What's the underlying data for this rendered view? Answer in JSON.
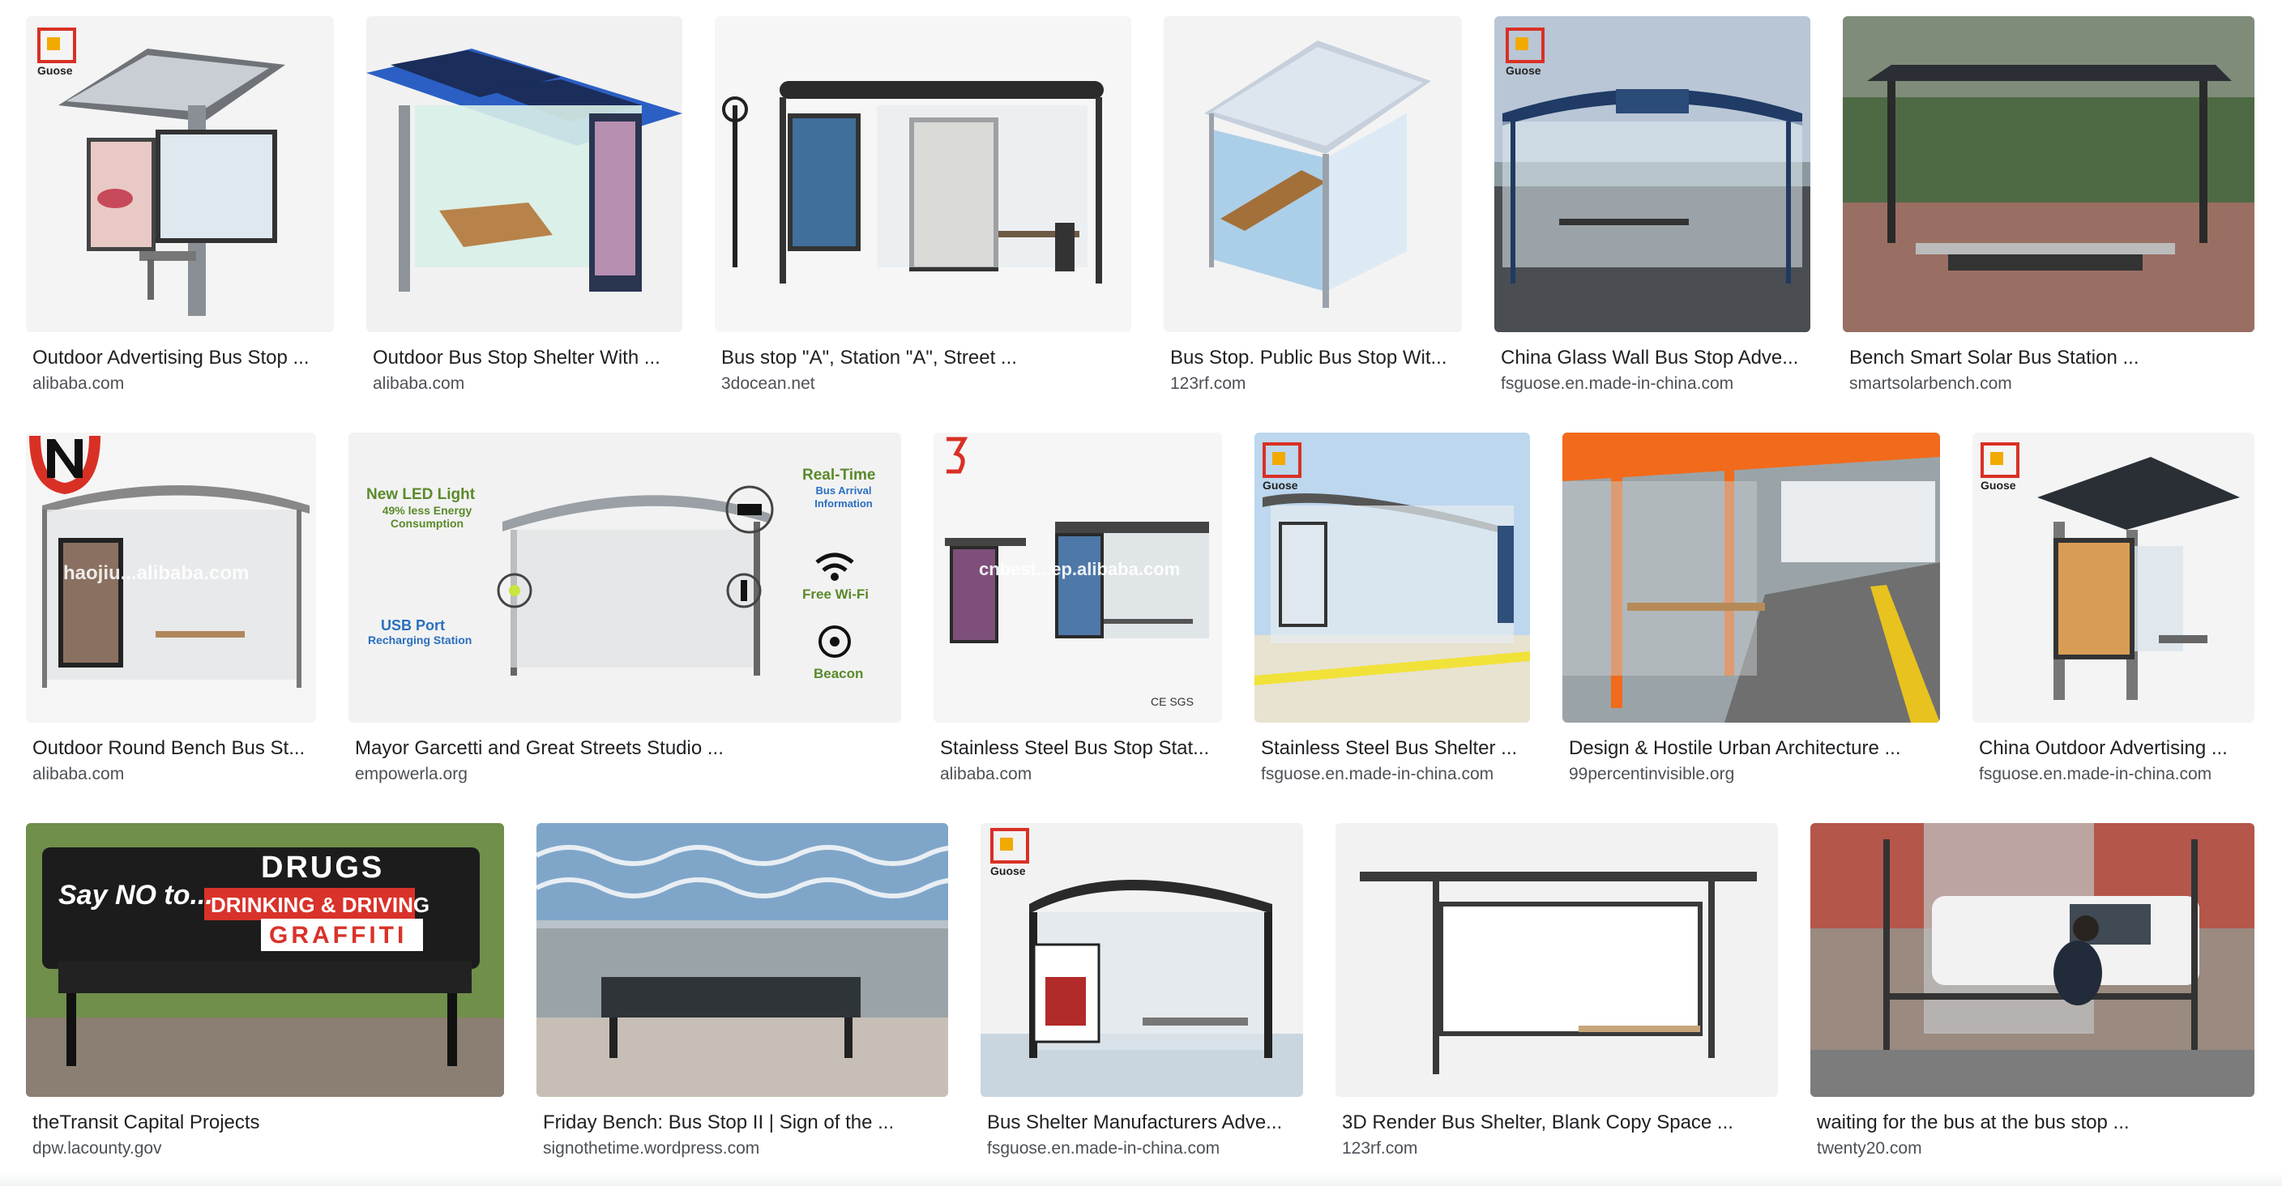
{
  "results": [
    {
      "title": "Outdoor Advertising Bus Stop ...",
      "source": "alibaba.com",
      "logo": "guose"
    },
    {
      "title": "Outdoor Bus Stop Shelter With ...",
      "source": "alibaba.com",
      "logo": ""
    },
    {
      "title": "Bus stop \"A\", Station \"A\", Street ...",
      "source": "3docean.net",
      "logo": ""
    },
    {
      "title": "Bus Stop. Public Bus Stop Wit...",
      "source": "123rf.com",
      "logo": ""
    },
    {
      "title": "China Glass Wall Bus Stop Adve...",
      "source": "fsguose.en.made-in-china.com",
      "logo": "guose"
    },
    {
      "title": "Bench Smart Solar Bus Station ...",
      "source": "smartsolarbench.com",
      "logo": ""
    },
    {
      "title": "Outdoor Round Bench Bus St...",
      "source": "alibaba.com",
      "logo": "",
      "watermark": "haojiu...alibaba.com"
    },
    {
      "title": "Mayor Garcetti and Great Streets Studio ...",
      "source": "empowerla.org",
      "logo": "",
      "infographic": {
        "led": "New LED Light",
        "led_sub": "49% less Energy Consumption",
        "realtime": "Real-Time",
        "realtime_sub": "Bus Arrival Information",
        "wifi": "Free Wi-Fi",
        "usb": "USB Port",
        "usb_sub": "Recharging Station",
        "beacon": "Beacon"
      }
    },
    {
      "title": "Stainless Steel Bus Stop Stat...",
      "source": "alibaba.com",
      "logo": "",
      "watermark": "cnbest...ep.alibaba.com",
      "badge": "CE SGS"
    },
    {
      "title": "Stainless Steel Bus Shelter ...",
      "source": "fsguose.en.made-in-china.com",
      "logo": "guose"
    },
    {
      "title": "Design & Hostile Urban Architecture ...",
      "source": "99percentinvisible.org",
      "logo": ""
    },
    {
      "title": "China Outdoor Advertising ...",
      "source": "fsguose.en.made-in-china.com",
      "logo": "guose"
    },
    {
      "title": "theTransit Capital Projects",
      "source": "dpw.lacounty.gov",
      "logo": "",
      "bench_ad": {
        "line1": "Say NO to...",
        "line2": "DRUGS",
        "line3": "DRINKING & DRIVING",
        "line4": "GRAFFITI"
      }
    },
    {
      "title": "Friday Bench: Bus Stop II | Sign of the ...",
      "source": "signothetime.wordpress.com",
      "logo": ""
    },
    {
      "title": "Bus Shelter Manufacturers Adve...",
      "source": "fsguose.en.made-in-china.com",
      "logo": "guose"
    },
    {
      "title": "3D Render Bus Shelter, Blank Copy Space ...",
      "source": "123rf.com",
      "logo": ""
    },
    {
      "title": "waiting for the bus at the bus stop ...",
      "source": "twenty20.com",
      "logo": ""
    }
  ],
  "logo_text": "Guose",
  "colors": {
    "title": "#202124",
    "source": "#4d5156",
    "logo_red": "#d93025"
  }
}
